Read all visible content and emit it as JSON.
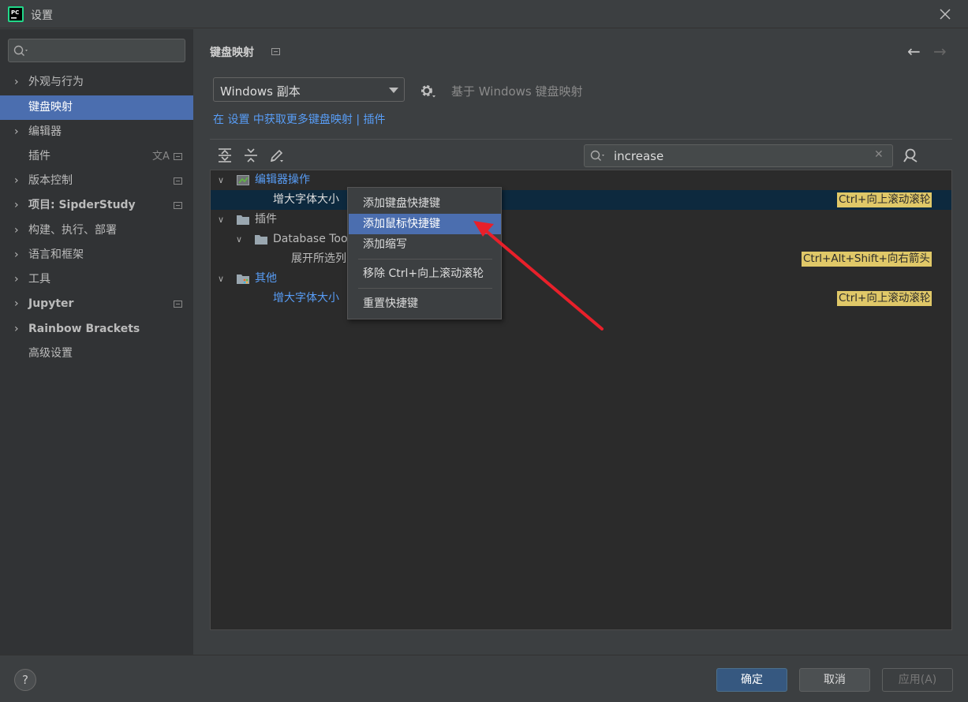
{
  "window": {
    "title": "设置",
    "logo_text": "PC"
  },
  "sidebar": {
    "search_placeholder": "",
    "items": [
      {
        "label": "外观与行为",
        "expandable": true
      },
      {
        "label": "键盘映射",
        "expandable": false,
        "active": true
      },
      {
        "label": "编辑器",
        "expandable": true
      },
      {
        "label": "插件",
        "expandable": false,
        "translate_icon": "文A"
      },
      {
        "label": "版本控制",
        "expandable": true
      },
      {
        "label": "项目: SipderStudy",
        "expandable": true
      },
      {
        "label": "构建、执行、部署",
        "expandable": true
      },
      {
        "label": "语言和框架",
        "expandable": true
      },
      {
        "label": "工具",
        "expandable": true
      },
      {
        "label": "Jupyter",
        "expandable": true
      },
      {
        "label": "Rainbow Brackets",
        "expandable": true
      },
      {
        "label": "高级设置",
        "expandable": false
      }
    ]
  },
  "main": {
    "title": "键盘映射",
    "keymap_value": "Windows 副本",
    "based_on": "基于 Windows 键盘映射",
    "links": {
      "prefix": "在 ",
      "settings": "设置",
      "middle": " 中获取更多键盘映射",
      "divider": " | ",
      "plugins": "插件"
    },
    "search_value": "increase",
    "tree": {
      "editor_actions": "编辑器操作",
      "increase_font": "增大字体大小",
      "increase_font_shortcut": "Ctrl+向上滚动滚轮",
      "plugins": "插件",
      "database_tools": "Database Too",
      "expand_selection": "展开所选列",
      "expand_selection_shortcut": "Ctrl+Alt+Shift+向右箭头",
      "other": "其他",
      "other_increase_font": "增大字体大小",
      "other_increase_font_shortcut": "Ctrl+向上滚动滚轮"
    }
  },
  "context_menu": {
    "items": [
      "添加键盘快捷键",
      "添加鼠标快捷键",
      "添加缩写",
      "移除 Ctrl+向上滚动滚轮",
      "重置快捷键"
    ],
    "highlighted_index": 1
  },
  "footer": {
    "help": "?",
    "ok": "确定",
    "cancel": "取消",
    "apply": "应用(A)"
  },
  "colors": {
    "accent": "#4b6eaf",
    "link": "#589df6",
    "shortcut_highlight": "#e0c868",
    "annotation_arrow": "#e8202a"
  }
}
